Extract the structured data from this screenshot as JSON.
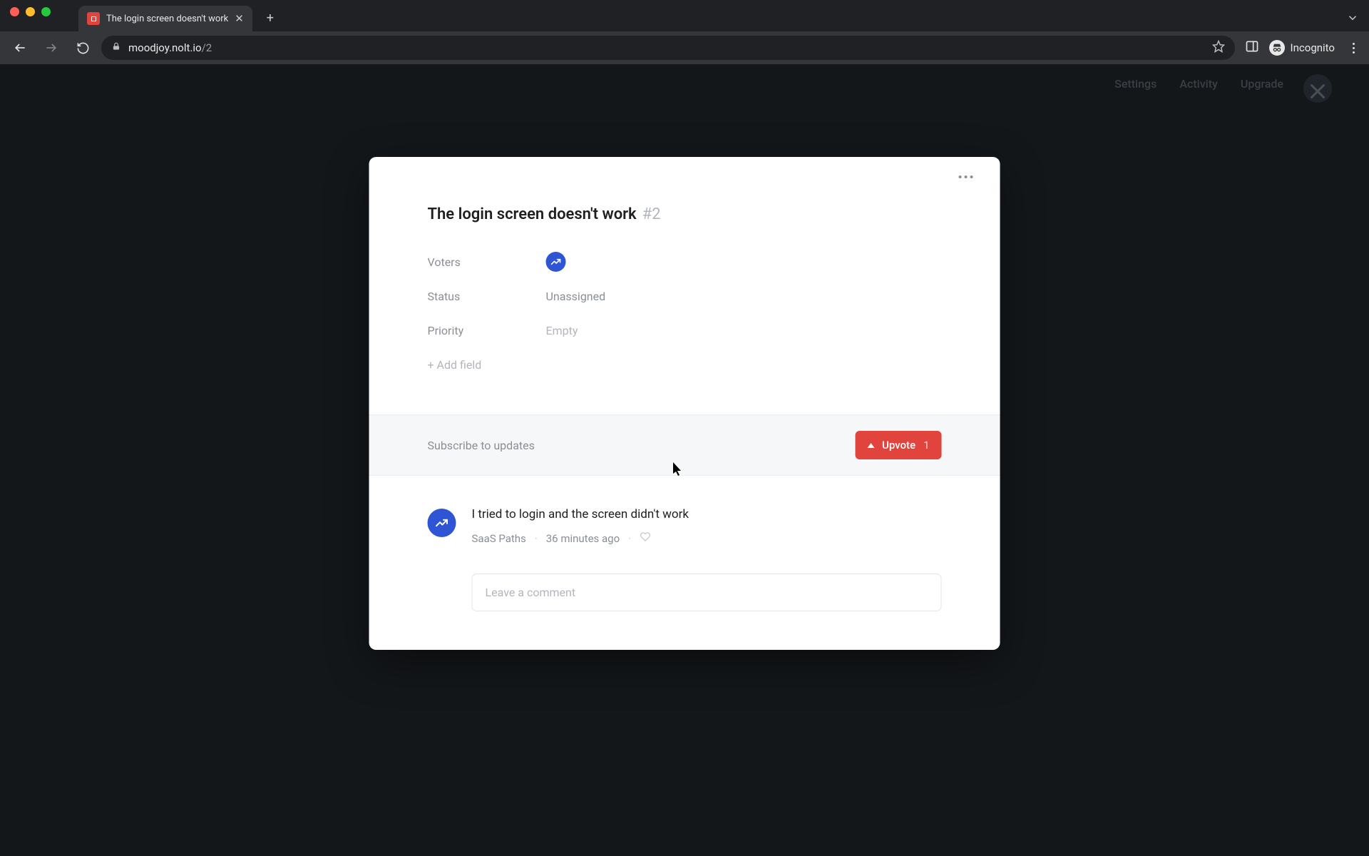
{
  "browser": {
    "tab_title": "The login screen doesn't work",
    "url_host": "moodjoy.nolt.io",
    "url_path": "/2",
    "incognito_label": "Incognito"
  },
  "page_nav": {
    "items": [
      "Settings",
      "Activity",
      "Upgrade"
    ]
  },
  "issue": {
    "title": "The login screen doesn't work",
    "id": "#2",
    "fields": {
      "voters_label": "Voters",
      "status_label": "Status",
      "status_value": "Unassigned",
      "priority_label": "Priority",
      "priority_value": "Empty",
      "add_field_label": "+ Add field"
    }
  },
  "actions": {
    "subscribe_label": "Subscribe to updates",
    "upvote_label": "Upvote",
    "upvote_count": "1"
  },
  "comments": [
    {
      "text": "I tried to login and the screen didn't work",
      "author": "SaaS Paths",
      "time": "36 minutes ago"
    }
  ],
  "comment_input": {
    "placeholder": "Leave a comment"
  }
}
